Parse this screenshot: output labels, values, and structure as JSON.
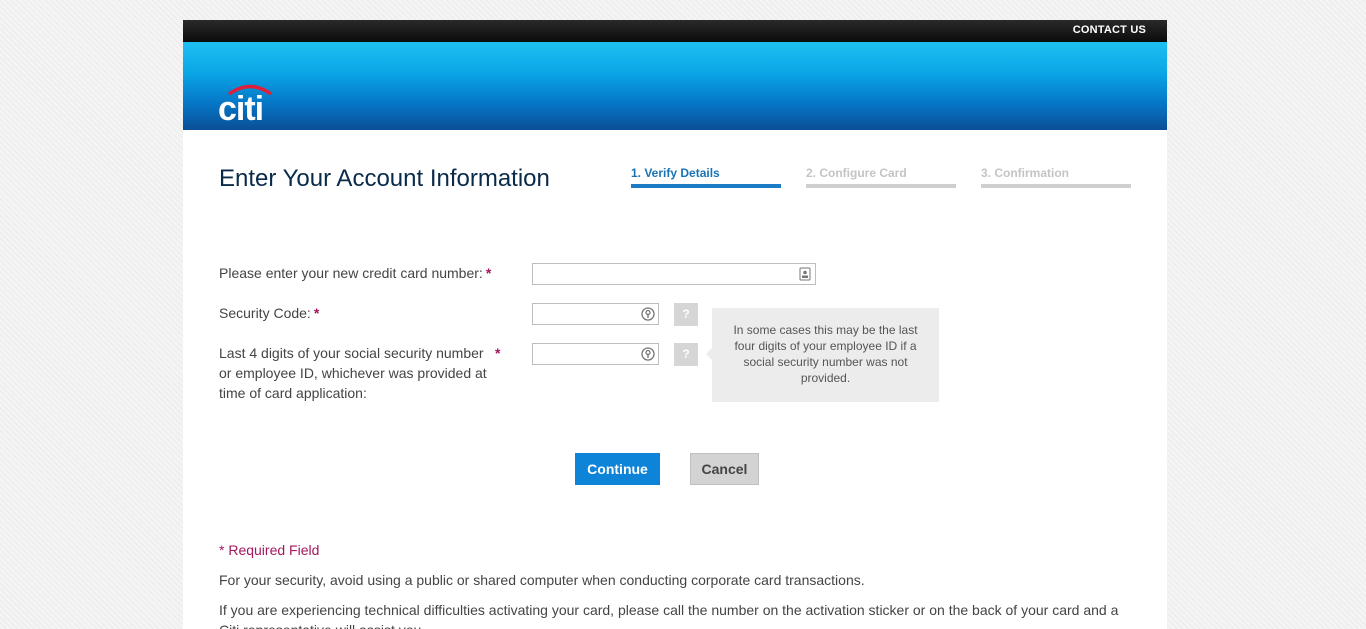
{
  "header": {
    "contact_label": "CONTACT US",
    "logo_text": "citi"
  },
  "page_title": "Enter Your Account Information",
  "steps": [
    {
      "label": "1. Verify Details",
      "state": "active"
    },
    {
      "label": "2. Configure Card",
      "state": "inactive"
    },
    {
      "label": "3. Confirmation",
      "state": "inactive"
    }
  ],
  "form": {
    "card_number": {
      "label": "Please enter your new credit card number:",
      "required_marker": "*",
      "value": "",
      "icon": "contact-card-icon"
    },
    "security_code": {
      "label": "Security Code:",
      "required_marker": "*",
      "value": "",
      "icon": "key-icon",
      "help_label": "?"
    },
    "ssn_last4": {
      "label_lines": [
        "Last 4 digits of your social security number",
        "or employee ID, whichever was provided at",
        "time of card application:"
      ],
      "required_marker": "*",
      "value": "",
      "icon": "key-icon",
      "help_label": "?"
    },
    "tooltip": "In some cases this may be the last four digits of your employee ID if a social security number was not provided."
  },
  "buttons": {
    "continue": "Continue",
    "cancel": "Cancel"
  },
  "notes": {
    "required": "* Required Field",
    "security": "For your security, avoid using a public or shared computer when conducting corporate card transactions.",
    "support": "If you are experiencing technical difficulties activating your card, please call the number on the activation sticker or on the back of your card and a Citi representative will assist you."
  },
  "colors": {
    "brand_blue": "#0a9fe0",
    "accent": "#a3175e",
    "primary_button": "#0d84d8"
  }
}
